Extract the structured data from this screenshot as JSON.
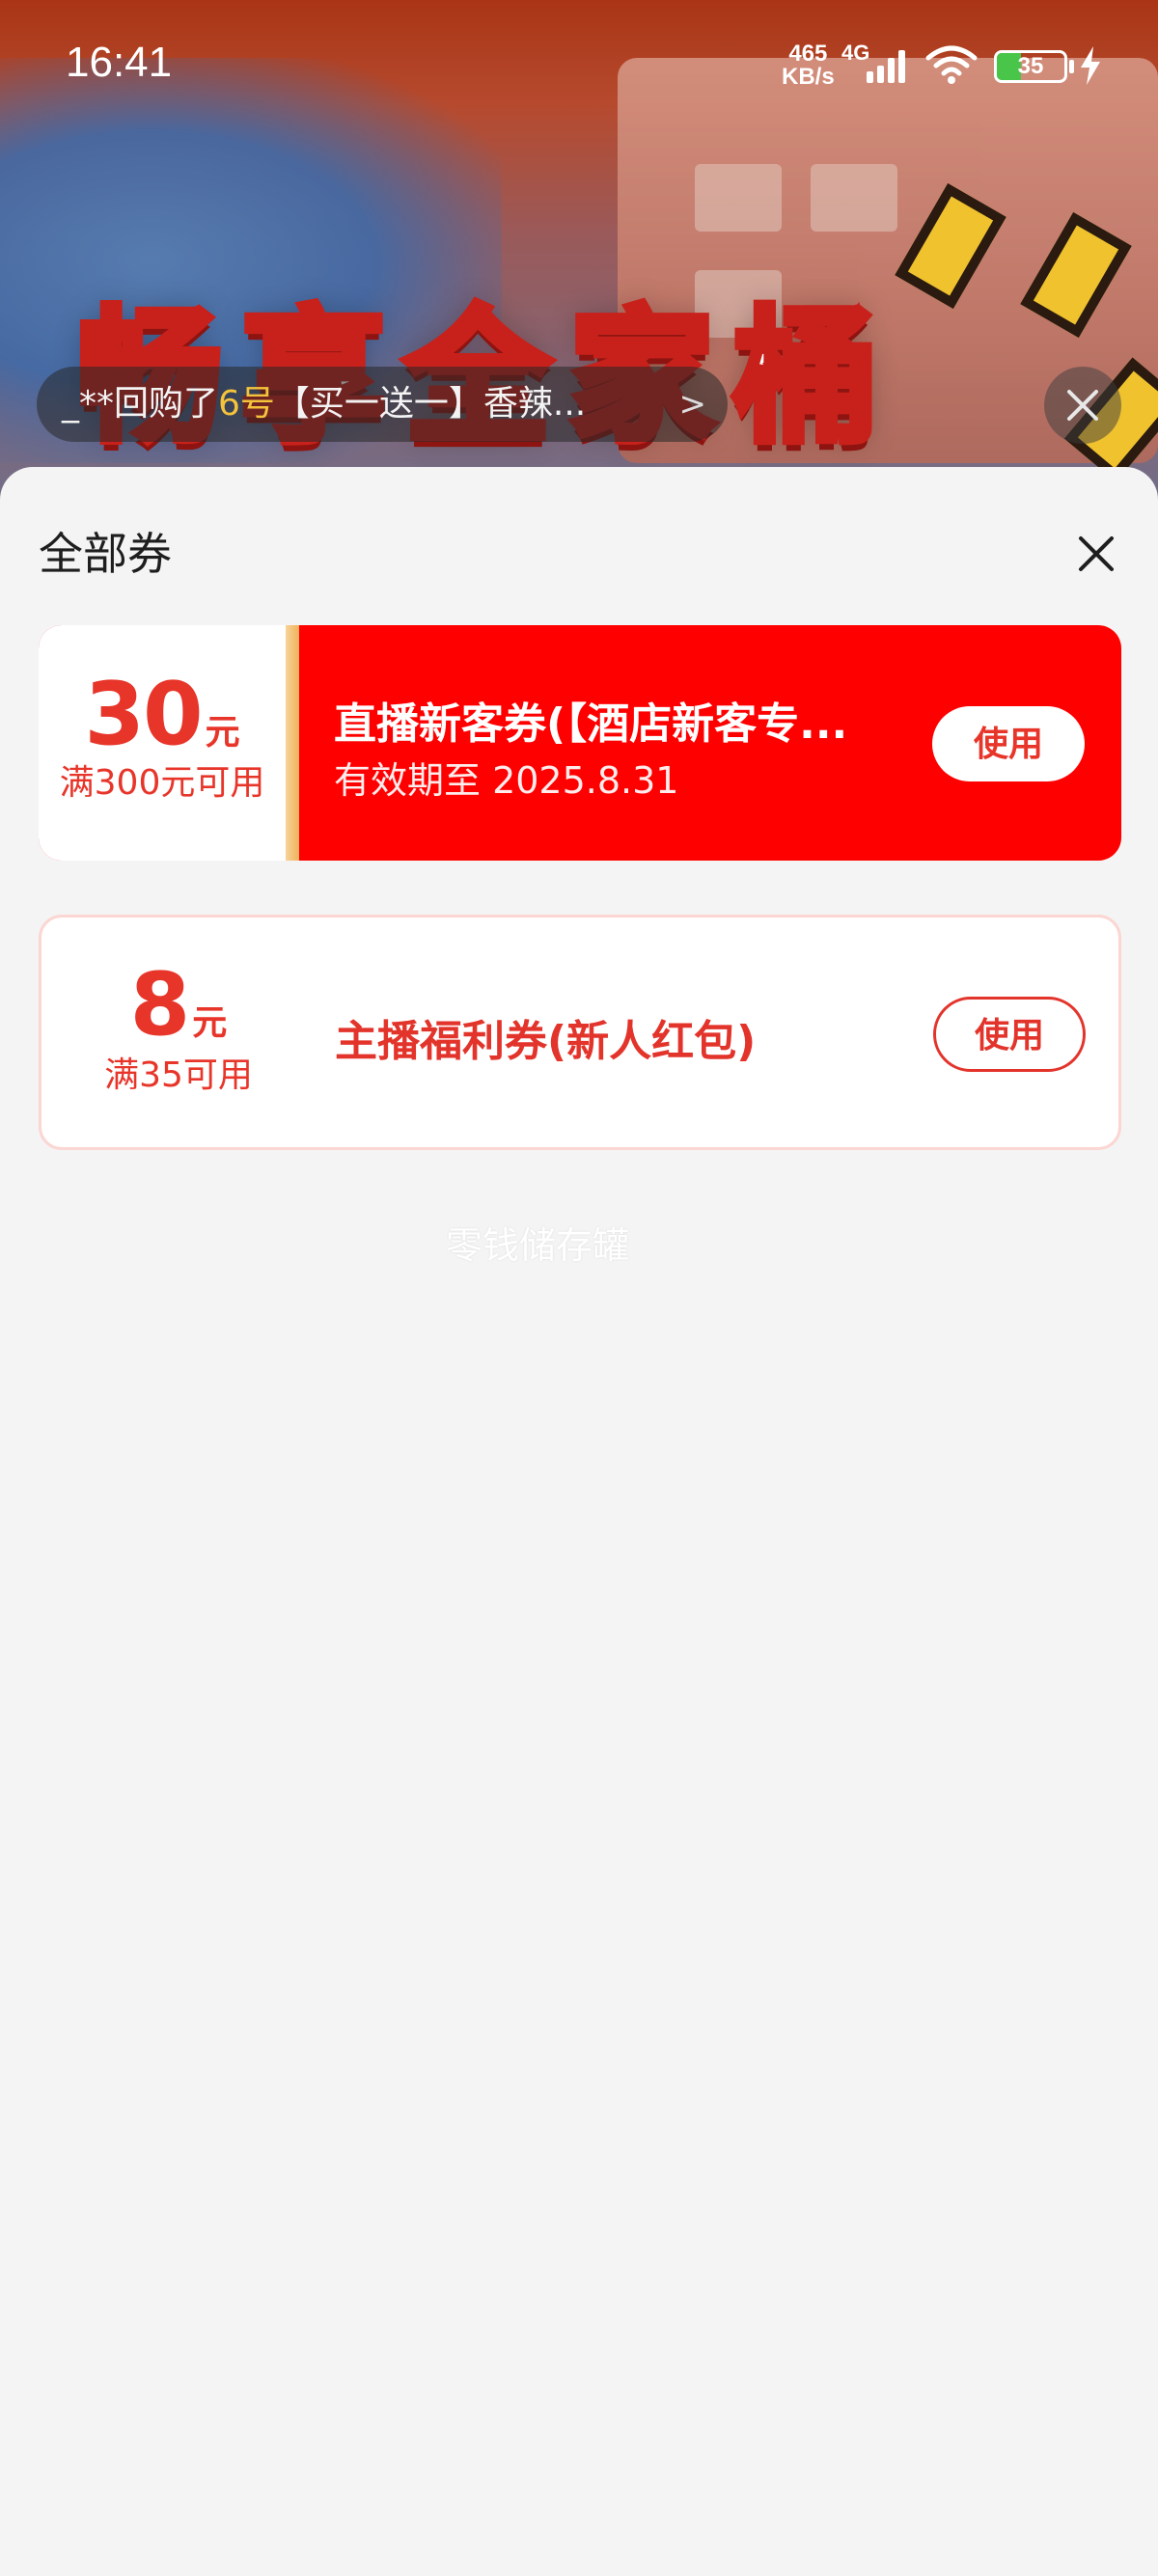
{
  "status_bar": {
    "time": "16:41",
    "net_speed_value": "465",
    "net_speed_unit": "KB/s",
    "network_type": "4G",
    "battery_level": "35",
    "battery_fraction": 0.35
  },
  "background": {
    "banner_text": "畅享全家桶"
  },
  "ticker": {
    "prefix": "_**回购了",
    "highlight": "6号",
    "suffix": "【买一送一】香辣...",
    "arrow": ">"
  },
  "sheet": {
    "title": "全部券"
  },
  "coupons": [
    {
      "amount": "30",
      "unit": "元",
      "condition": "满300元可用",
      "title": "直播新客券(【酒店新客专...",
      "validity": "有效期至 2025.8.31",
      "button_label": "使用"
    },
    {
      "amount": "8",
      "unit": "元",
      "condition": "满35可用",
      "title": "主播福利券(新人红包)",
      "button_label": "使用"
    }
  ],
  "watermark": "零钱储存罐",
  "colors": {
    "accent_red": "#ff0000",
    "text_red": "#e8352a",
    "ticker_highlight": "#f5c33b"
  }
}
